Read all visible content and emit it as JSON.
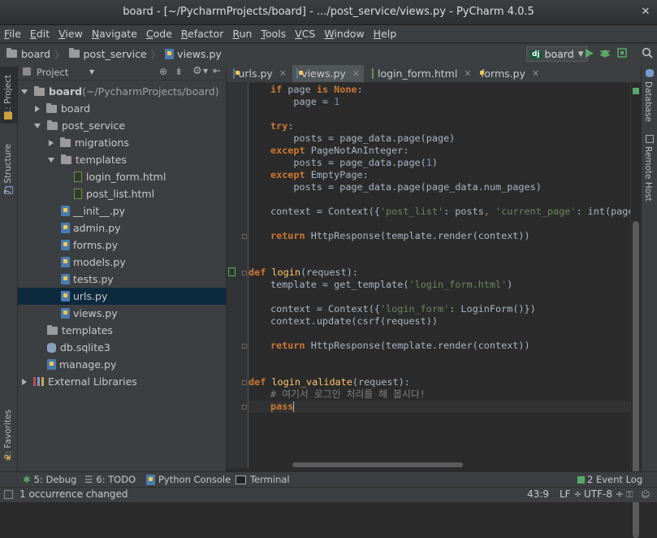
{
  "window": {
    "title": "board - [~/PycharmProjects/board] - .../post_service/views.py - PyCharm 4.0.5",
    "close_glyph": "✕"
  },
  "menu": [
    "File",
    "Edit",
    "View",
    "Navigate",
    "Code",
    "Refactor",
    "Run",
    "Tools",
    "VCS",
    "Window",
    "Help"
  ],
  "breadcrumb": {
    "items": [
      "board",
      "post_service",
      "views.py"
    ]
  },
  "run_config": {
    "badge": "dj",
    "label": "board"
  },
  "left_tabs": {
    "project": "1: Project",
    "structure": "7: Structure",
    "favorites": "2: Favorites"
  },
  "right_tabs": {
    "database": "Database",
    "remote_host": "Remote Host"
  },
  "project_panel": {
    "view_label": "Project"
  },
  "tree": [
    {
      "label": "board",
      "suffix": " (~/PycharmProjects/board)",
      "type": "folder",
      "expanded": true
    },
    {
      "label": "board",
      "type": "folder",
      "expanded": false
    },
    {
      "label": "post_service",
      "type": "folder",
      "expanded": true
    },
    {
      "label": "migrations",
      "type": "folder",
      "expanded": false
    },
    {
      "label": "templates",
      "type": "folder",
      "expanded": true
    },
    {
      "label": "login_form.html",
      "type": "html"
    },
    {
      "label": "post_list.html",
      "type": "html"
    },
    {
      "label": "__init__.py",
      "type": "py"
    },
    {
      "label": "admin.py",
      "type": "py"
    },
    {
      "label": "forms.py",
      "type": "py"
    },
    {
      "label": "models.py",
      "type": "py"
    },
    {
      "label": "tests.py",
      "type": "py"
    },
    {
      "label": "urls.py",
      "type": "py",
      "selected": true
    },
    {
      "label": "views.py",
      "type": "py"
    },
    {
      "label": "templates",
      "type": "folder"
    },
    {
      "label": "db.sqlite3",
      "type": "db"
    },
    {
      "label": "manage.py",
      "type": "py"
    },
    {
      "label": "External Libraries",
      "type": "lib",
      "expanded": false
    }
  ],
  "tabs": [
    {
      "label": "urls.py",
      "type": "py"
    },
    {
      "label": "views.py",
      "type": "py",
      "active": true
    },
    {
      "label": "login_form.html",
      "type": "html"
    },
    {
      "label": "forms.py",
      "type": "py"
    }
  ],
  "code": {
    "l1": {
      "a": "if",
      "b": " page ",
      "c": "is",
      "d": " ",
      "e": "None",
      "f": ":"
    },
    "l2": {
      "a": "    page = ",
      "b": "1"
    },
    "l3": {
      "a": "try",
      "b": ":"
    },
    "l4": {
      "a": "    posts = page_data.page(page)"
    },
    "l5": {
      "a": "except",
      "b": " PageNotAnInteger:"
    },
    "l6": {
      "a": "    posts = page_data.page(",
      "b": "1",
      "c": ")"
    },
    "l7": {
      "a": "except",
      "b": " EmptyPage:"
    },
    "l8": {
      "a": "    posts = page_data.page(page_data.num_pages)"
    },
    "l9": {
      "a": "context = Context({",
      "b": "'post_list'",
      "c": ": posts",
      "d": ", ",
      "e": "'current_page'",
      "f": ": int(page)",
      "g": ","
    },
    "l10": {
      "a": "return",
      "b": " HttpResponse(template.render(context))"
    },
    "l11": {
      "a": "def",
      "b": " ",
      "c": "login",
      "d": "(request):"
    },
    "l12": {
      "a": "template = get_template(",
      "b": "'login_form.html'",
      "c": ")"
    },
    "l13": {
      "a": "context = Context({",
      "b": "'login_form'",
      "c": ": LoginForm()})"
    },
    "l14": {
      "a": "context.update(csrf(request))"
    },
    "l15": {
      "a": "return",
      "b": " HttpResponse(template.render(context))"
    },
    "l16": {
      "a": "def",
      "b": " ",
      "c": "login_validate",
      "d": "(request):"
    },
    "l17": {
      "a": "# 여기서 로그인 처리를 해 봅시다!"
    },
    "l18": {
      "a": "pass"
    }
  },
  "toolwindows": {
    "debug": "5: Debug",
    "todo": "6: TODO",
    "python_console": "Python Console",
    "terminal": "Terminal",
    "event_log": "2 Event Log"
  },
  "status": {
    "message": "1 occurrence changed",
    "position": "43:9",
    "line_sep": "LF ÷",
    "encoding": "UTF-8 ÷"
  }
}
